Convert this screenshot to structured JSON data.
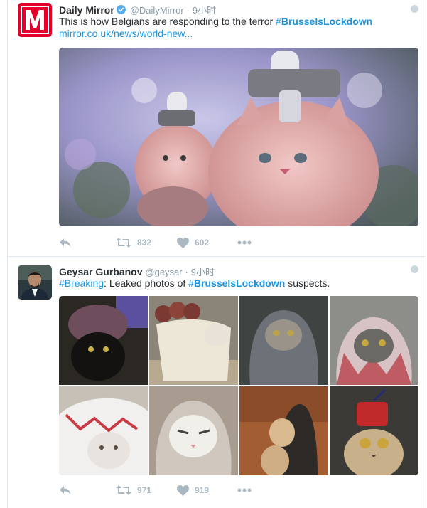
{
  "tweets": [
    {
      "display_name": "Daily Mirror",
      "handle": "@DailyMirror",
      "separator": "·",
      "time": "9小时",
      "text_before": "This is how Belgians are responding to the terror ",
      "hashtag_symbol": "#",
      "hashtag_word": "BrusselsLockdown",
      "text_after": "",
      "link": "mirror.co.uk/news/world-new...",
      "retweet_count": "832",
      "like_count": "602"
    },
    {
      "display_name": "Geysar Gurbanov",
      "handle": "@geysar",
      "separator": "·",
      "time": "9小时",
      "lead_hashtag": "#Breaking",
      "text_mid": ": Leaked photos of ",
      "hashtag_symbol": "#",
      "hashtag_word": "BrusselsLockdown",
      "text_after": " suspects.",
      "retweet_count": "971",
      "like_count": "919"
    }
  ],
  "colors": {
    "link": "#1b95e0",
    "verified": "#55acee",
    "mirror_red": "#e4002b",
    "action_gray": "#aab8c2"
  },
  "icons": [
    "verified-badge-icon",
    "chevron-down-icon",
    "reply-icon",
    "retweet-icon",
    "like-icon",
    "more-icon"
  ]
}
